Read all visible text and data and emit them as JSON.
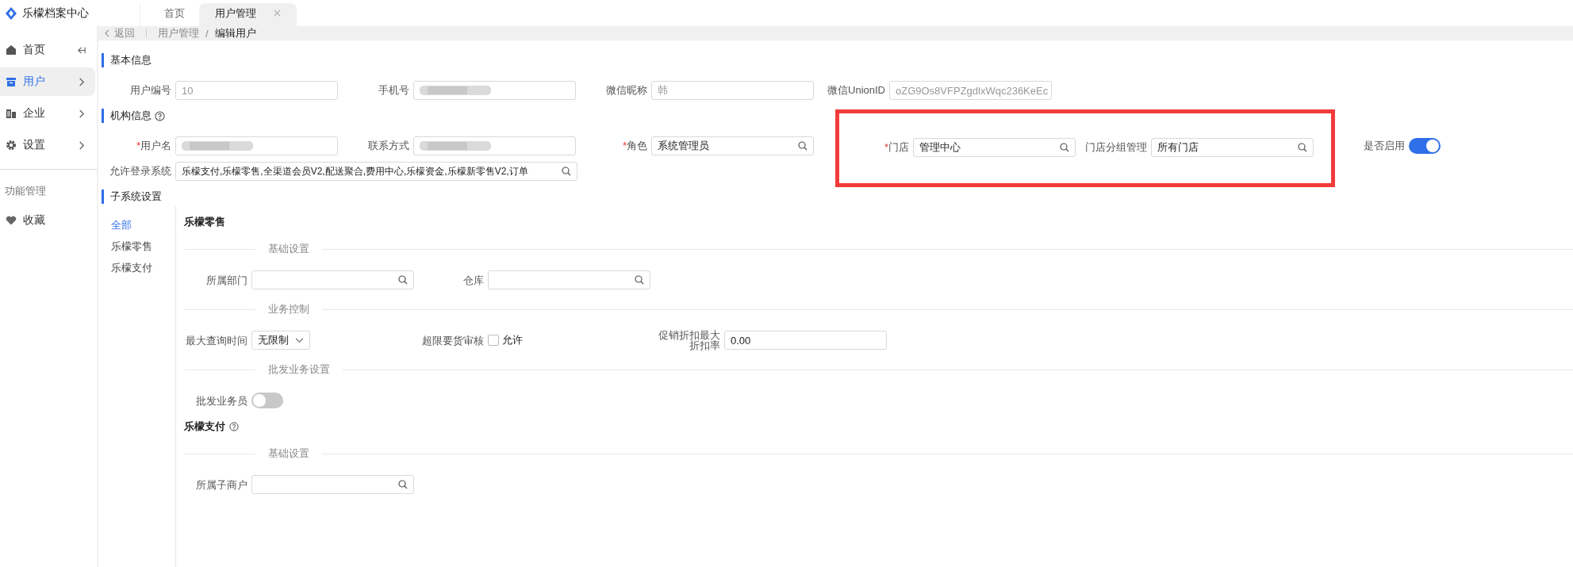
{
  "app": {
    "title": "乐檬档案中心"
  },
  "tabs": [
    {
      "label": "首页",
      "selected": false,
      "closable": false
    },
    {
      "label": "用户管理",
      "selected": true,
      "closable": true
    }
  ],
  "sidebar": {
    "items": [
      {
        "label": "首页",
        "selected": false
      },
      {
        "label": "用户",
        "selected": true
      },
      {
        "label": "企业",
        "selected": false
      },
      {
        "label": "设置",
        "selected": false
      }
    ],
    "section": "功能管理",
    "extra_items": [
      {
        "label": "收藏"
      }
    ]
  },
  "breadcrumb": {
    "back": "返回",
    "separator": "/",
    "path": [
      {
        "label": "用户管理",
        "current": false
      },
      {
        "label": "编辑用户",
        "current": true
      }
    ]
  },
  "required_mark": "*",
  "basic_info": {
    "title": "基本信息",
    "rows": [
      [
        {
          "label": "用户编号",
          "kind": "text",
          "value": "10",
          "disabled": true,
          "required": false
        },
        {
          "label": "手机号",
          "kind": "redacted",
          "required": false
        },
        {
          "label": "微信昵称",
          "kind": "text",
          "value": "韩",
          "disabled": true,
          "required": false
        },
        {
          "label": "微信UnionID",
          "kind": "text",
          "value": "oZG9Os8VFPZgdlxWqc236KeEc",
          "disabled": true,
          "required": false
        }
      ]
    ]
  },
  "org_info": {
    "title": "机构信息",
    "help": true,
    "rows": [
      [
        {
          "label": "用户名",
          "kind": "redacted",
          "required": true
        },
        {
          "label": "联系方式",
          "kind": "redacted",
          "required": false
        },
        {
          "label": "角色",
          "kind": "search",
          "value": "系统管理员",
          "disabled": false,
          "required": true
        },
        {
          "label": "门店",
          "kind": "search",
          "value": "管理中心",
          "disabled": false,
          "required": true,
          "highlighted": true
        },
        {
          "label": "门店分组管理",
          "kind": "search",
          "value": "所有门店",
          "disabled": false,
          "required": false,
          "highlighted": true
        },
        {
          "label": "是否启用",
          "kind": "toggle",
          "on": true,
          "required": false
        }
      ],
      [
        {
          "label": "允许登录系统",
          "kind": "wide_search",
          "value": "乐檬支付,乐檬零售,全渠道会员V2,配送聚合,费用中心,乐檬资金,乐檬新零售V2,订单",
          "disabled": false,
          "required": false
        }
      ]
    ]
  },
  "subsystems": {
    "title": "子系统设置",
    "nav": [
      {
        "label": "全部",
        "selected": true
      },
      {
        "label": "乐檬零售",
        "selected": false
      },
      {
        "label": "乐檬支付",
        "selected": false
      }
    ],
    "groups": [
      {
        "title": "乐檬零售",
        "sections": [
          {
            "title": "基础设置",
            "rows": [
              [
                {
                  "label": "所属部门",
                  "kind": "search"
                },
                {
                  "label": "仓库",
                  "kind": "search"
                }
              ]
            ]
          },
          {
            "title": "业务控制",
            "rows": [
              [
                {
                  "label": "最大查询时间",
                  "kind": "select",
                  "value": "无限制"
                },
                {
                  "label": "超限要货审核",
                  "kind": "checkbox",
                  "option": "允许",
                  "checked": false
                },
                {
                  "label": "促销折扣最大折扣率",
                  "kind": "text",
                  "value": "0.00"
                }
              ]
            ]
          },
          {
            "title": "批发业务设置",
            "rows": [
              [
                {
                  "label": "批发业务员",
                  "kind": "toggle",
                  "on": false
                }
              ]
            ]
          }
        ]
      },
      {
        "title": "乐檬支付",
        "help": true,
        "sections": [
          {
            "title": "基础设置",
            "rows": [
              [
                {
                  "label": "所属子商户",
                  "kind": "search"
                }
              ]
            ]
          }
        ]
      }
    ]
  }
}
